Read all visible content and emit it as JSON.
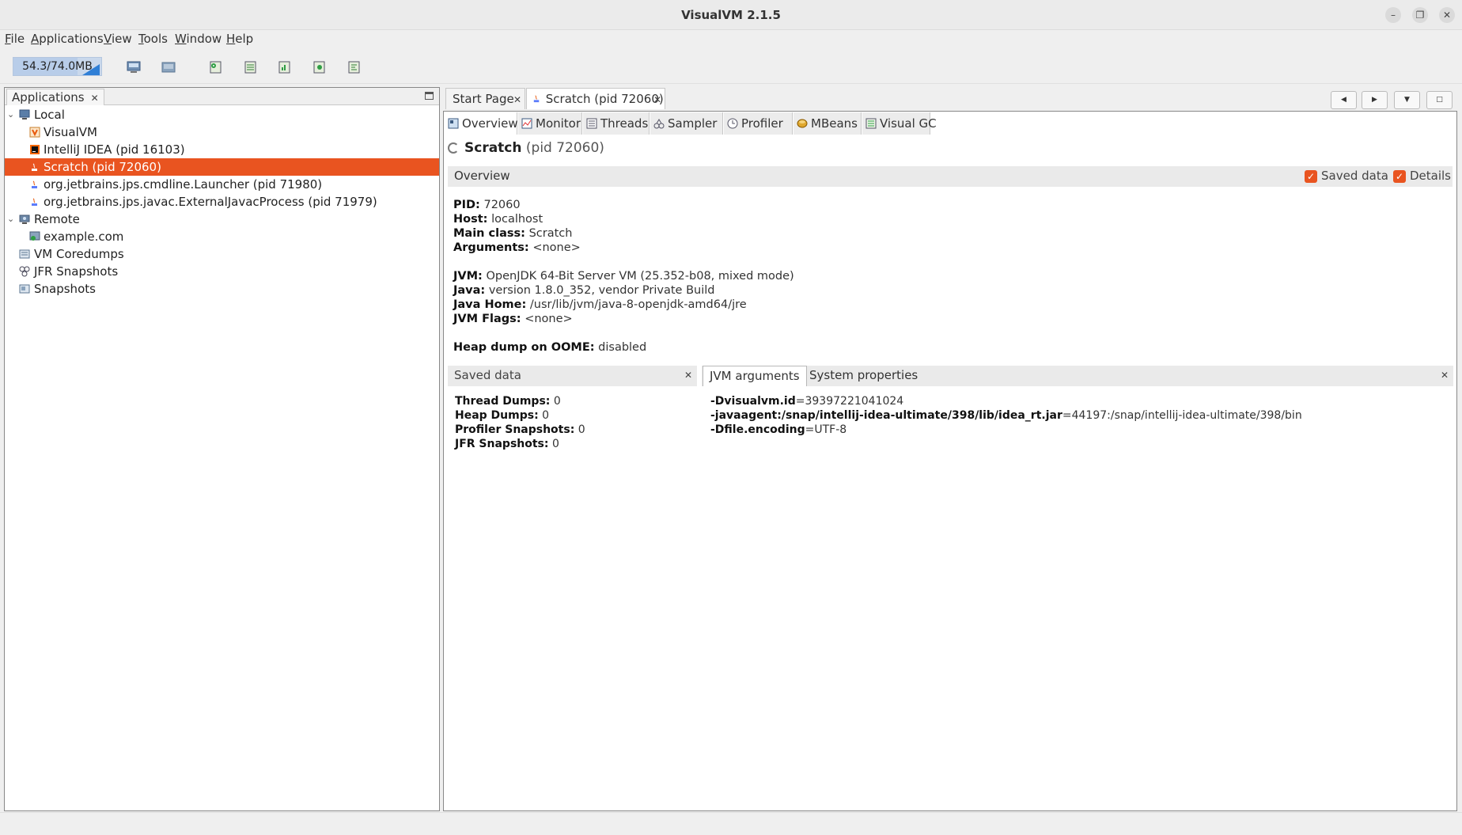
{
  "window": {
    "title": "VisualVM 2.1.5",
    "buttons": [
      "minimize",
      "restore",
      "close"
    ]
  },
  "menu": [
    "File",
    "Applications",
    "View",
    "Tools",
    "Window",
    "Help"
  ],
  "toolbar": {
    "memory_text": "54.3/74.0MB",
    "memory_used_fraction": 0.734,
    "icons": [
      "add-jmx-connection-icon",
      "add-remote-host-icon",
      "heap-dump-icon",
      "thread-dump-icon",
      "profiler-snapshot-icon",
      "application-snapshot-icon",
      "jfr-snapshot-icon"
    ]
  },
  "left_panel": {
    "tab_label": "Applications",
    "tree": [
      {
        "label": "Local",
        "level": 0,
        "expanded": true
      },
      {
        "label": "VisualVM",
        "level": 1
      },
      {
        "label": "IntelliJ IDEA (pid 16103)",
        "level": 1
      },
      {
        "label": "Scratch (pid 72060)",
        "level": 1,
        "selected": true
      },
      {
        "label": "org.jetbrains.jps.cmdline.Launcher (pid 71980)",
        "level": 1
      },
      {
        "label": "org.jetbrains.jps.javac.ExternalJavacProcess (pid 71979)",
        "level": 1
      },
      {
        "label": "Remote",
        "level": 0,
        "expanded": true
      },
      {
        "label": "example.com",
        "level": 1
      },
      {
        "label": "VM Coredumps",
        "level": 0
      },
      {
        "label": "JFR Snapshots",
        "level": 0
      },
      {
        "label": "Snapshots",
        "level": 0
      }
    ]
  },
  "document_tabs": [
    {
      "label": "Start Page"
    },
    {
      "label": "Scratch (pid 72060)",
      "active": true
    }
  ],
  "view_tabs": [
    "Overview",
    "Monitor",
    "Threads",
    "Sampler",
    "Profiler",
    "MBeans",
    "Visual GC"
  ],
  "overview": {
    "app_name": "Scratch",
    "app_pid": "(pid 72060)",
    "section_title": "Overview",
    "saved_data_checkbox": "Saved data",
    "details_checkbox": "Details",
    "info": [
      {
        "key": "PID:",
        "value": "72060"
      },
      {
        "key": "Host:",
        "value": "localhost"
      },
      {
        "key": "Main class:",
        "value": "Scratch"
      },
      {
        "key": "Arguments:",
        "value": "<none>"
      },
      {
        "key": "JVM:",
        "value": "OpenJDK 64-Bit Server VM (25.352-b08, mixed mode)"
      },
      {
        "key": "Java:",
        "value": "version 1.8.0_352, vendor Private Build"
      },
      {
        "key": "Java Home:",
        "value": "/usr/lib/jvm/java-8-openjdk-amd64/jre"
      },
      {
        "key": "JVM Flags:",
        "value": "<none>"
      },
      {
        "key": "Heap dump on OOME:",
        "value": "disabled"
      }
    ],
    "saved_data": {
      "title": "Saved data",
      "items": [
        {
          "key": "Thread Dumps:",
          "value": "0"
        },
        {
          "key": "Heap Dumps:",
          "value": "0"
        },
        {
          "key": "Profiler Snapshots:",
          "value": "0"
        },
        {
          "key": "JFR Snapshots:",
          "value": "0"
        }
      ]
    },
    "details_tabs": [
      "JVM arguments",
      "System properties"
    ],
    "jvm_args": [
      {
        "key": "-Dvisualvm.id",
        "value": "=39397221041024"
      },
      {
        "key": "-javaagent:/snap/intellij-idea-ultimate/398/lib/idea_rt.jar",
        "value": "=44197:/snap/intellij-idea-ultimate/398/bin"
      },
      {
        "key": "-Dfile.encoding",
        "value": "=UTF-8"
      }
    ]
  }
}
